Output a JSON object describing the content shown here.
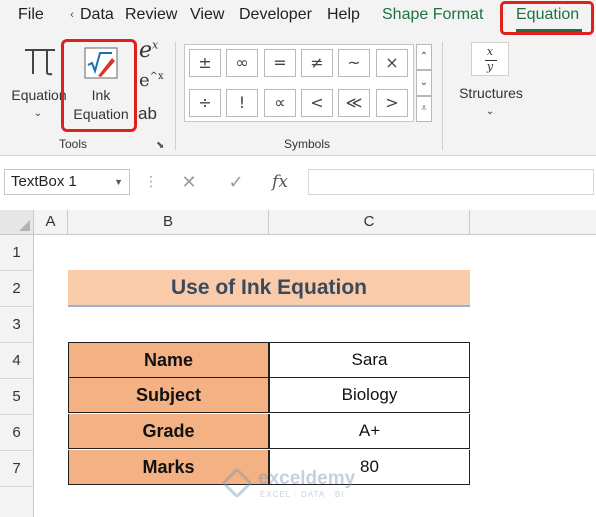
{
  "ribbon_tabs": {
    "file": "File",
    "data": "Data",
    "review": "Review",
    "view": "View",
    "developer": "Developer",
    "help": "Help",
    "shape_format": "Shape Format",
    "equation": "Equation"
  },
  "colors": {
    "accent_green": "#1e7145",
    "highlight_red": "#e0201c",
    "header_fill": "#f4b183",
    "title_fill": "#f9cbab"
  },
  "tools_group": {
    "equation_label": "Equation",
    "ink_line1": "Ink",
    "ink_line2": "Equation",
    "group_label": "Tools"
  },
  "symbols_group": {
    "row1": [
      "±",
      "∞",
      "=",
      "≠",
      "~",
      "×"
    ],
    "row2": [
      "÷",
      "!",
      "∝",
      "<",
      "≪",
      ">"
    ],
    "group_label": "Symbols"
  },
  "structures_group": {
    "label": "Structures",
    "icon_num": "x",
    "icon_den": "y"
  },
  "formula_bar": {
    "name_box": "TextBox 1",
    "cancel_glyph": "✕",
    "enter_glyph": "✓",
    "fx_glyph": "fx",
    "formula": ""
  },
  "grid": {
    "columns": [
      "A",
      "B",
      "C"
    ],
    "rows": [
      "1",
      "2",
      "3",
      "4",
      "5",
      "6",
      "7"
    ],
    "title": "Use of Ink Equation",
    "table": [
      {
        "label": "Name",
        "value": "Sara"
      },
      {
        "label": "Subject",
        "value": "Biology"
      },
      {
        "label": "Grade",
        "value": "A+"
      },
      {
        "label": "Marks",
        "value": "80"
      }
    ]
  },
  "watermark": {
    "name": "exceldemy",
    "tagline": "EXCEL · DATA · BI"
  }
}
